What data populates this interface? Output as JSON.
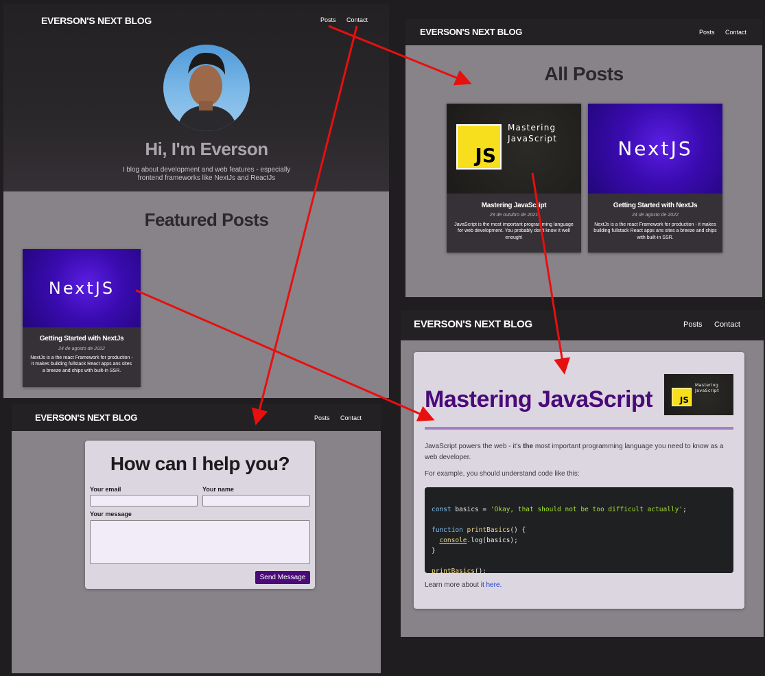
{
  "site": {
    "logo": "EVERSON'S NEXT BLOG",
    "nav_posts": "Posts",
    "nav_contact": "Contact"
  },
  "home": {
    "hero_title": "Hi, I'm Everson",
    "hero_subtitle_1": "I blog about development and web features - especially",
    "hero_subtitle_2": "frontend frameworks like NextJs and ReactJs",
    "featured_heading": "Featured Posts",
    "featured_card": {
      "thumb_text": "NextJS",
      "title": "Getting Started with NextJs",
      "date": "24 de agosto de 2022",
      "excerpt": "NextJs is a the react Framework for production - it makes building fullstack React apps ans sites a breeze and ships with built-in SSR."
    }
  },
  "all_posts": {
    "heading": "All Posts",
    "cards": [
      {
        "thumb_js": "JS",
        "thumb_caption_1": "Mastering",
        "thumb_caption_2": "JavaScript",
        "title": "Mastering JavaScript",
        "date": "29 de outubro de 2021",
        "excerpt": "JavaScript is the most important programming language for web development. You probably don't know it well enough!"
      },
      {
        "thumb_text": "NextJS",
        "title": "Getting Started with NextJs",
        "date": "24 de agosto de 2022",
        "excerpt": "NextJs is a the react Framework for production - it makes building fullstack React apps ans sites a breeze and ships with built-in SSR."
      }
    ]
  },
  "contact": {
    "heading": "How can I help you?",
    "email_label": "Your email",
    "name_label": "Your name",
    "message_label": "Your message",
    "email_value": "",
    "name_value": "",
    "message_value": "",
    "send_button": "Send Message"
  },
  "post_detail": {
    "title": "Mastering JavaScript",
    "thumb_js": "JS",
    "thumb_caption_1": "Mastering",
    "thumb_caption_2": "JavaScript",
    "para1_before": "JavaScript powers the web - it's ",
    "para1_bold": "the",
    "para1_after_1": " most important programming language you need to know as a",
    "para1_after_2": "web developer.",
    "para2": "For example, you should understand code like this:",
    "code": {
      "l1_kw": "const",
      "l1_mid": " basics = ",
      "l1_str": "'Okay, that should not be too difficult actually'",
      "l1_end": ";",
      "l3_kw": "function",
      "l3_fn": "printBasics",
      "l3_end": "() {",
      "l4_obj": "console",
      "l4_end": ".log(basics);",
      "l5": "}",
      "l7_fn": "printBasics",
      "l7_end": "();"
    },
    "learn_more": "Learn more about it ",
    "learn_link": "here."
  },
  "colors": {
    "accent_purple": "#4a0a78",
    "arrow_red": "#e80f0f",
    "link_blue": "#1a3bd6"
  }
}
